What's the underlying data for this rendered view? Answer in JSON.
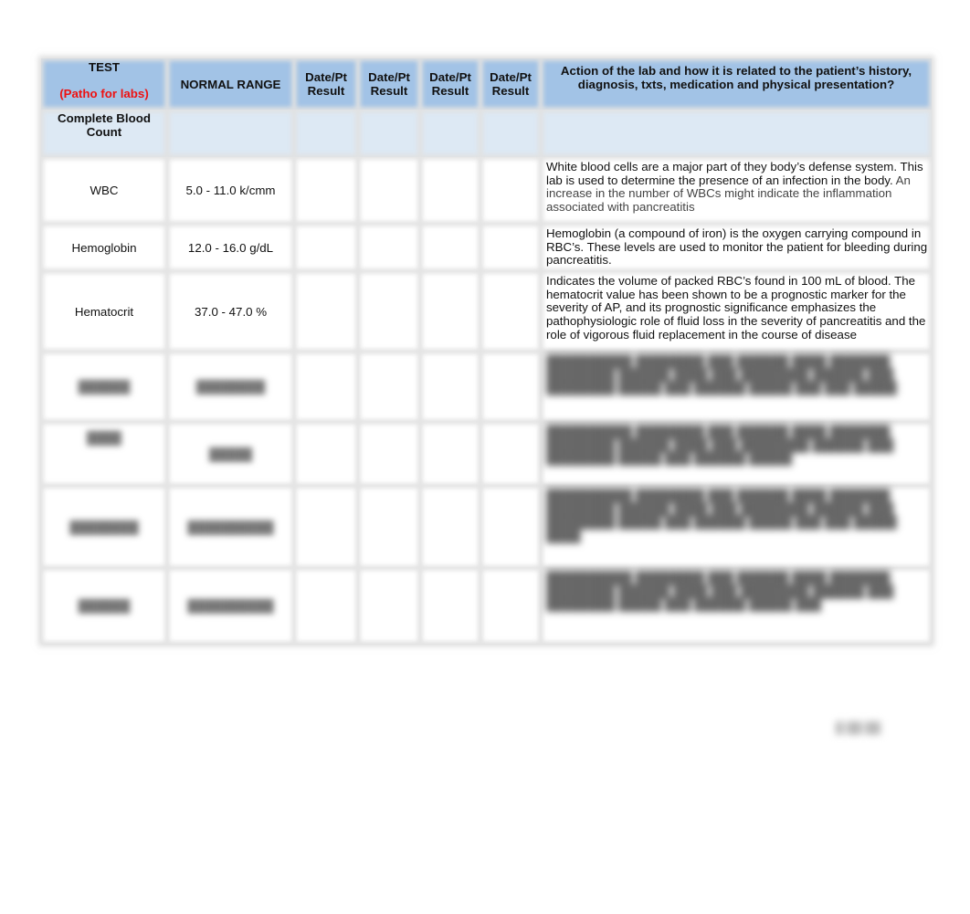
{
  "header": {
    "test_label": "TEST",
    "test_sublabel": "(Patho for labs)",
    "normal_range_label": "NORMAL RANGE",
    "result_columns": [
      "Date/Pt Result",
      "Date/Pt Result",
      "Date/Pt Result",
      "Date/Pt Result"
    ],
    "action_label": "Action of the lab and how it is related to the patient’s history, diagnosis, txts, medication and physical presentation?",
    "colors": {
      "header_bg": "#a2c3e6",
      "subheader_bg": "#dde9f4",
      "accent_red": "#ee1111"
    }
  },
  "section": {
    "label": "Complete Blood Count"
  },
  "rows": [
    {
      "test": "WBC",
      "range": "5.0 - 11.0 k/cmm",
      "results": [
        "",
        "",
        "",
        ""
      ],
      "action_main": "White blood cells are a major part of they body’s defense system. This lab is used to determine the presence of an infection in the body.",
      "action_extra": " An increase in the number of WBCs might indicate the inflammation associated with pancreatitis"
    },
    {
      "test": "Hemoglobin",
      "range": "12.0 - 16.0 g/dL",
      "results": [
        "",
        "",
        "",
        ""
      ],
      "action_main": "Hemoglobin (a compound of iron) is the oxygen carrying compound in RBC’s. These levels are used to monitor the patient for bleeding during pancreatitis.",
      "action_extra": ""
    },
    {
      "test": "Hematocrit",
      "range": "37.0 - 47.0 %",
      "results": [
        "",
        "",
        "",
        ""
      ],
      "action_main": "Indicates the volume of packed RBC’s found in 100 mL of blood. The hematocrit value has been shown to be a prognostic marker for the severity of AP, and its prognostic significance emphasizes the pathophysiologic role of fluid loss in the severity of pancreatitis and the role of vigorous fluid replacement in the course of disease",
      "action_extra": ""
    }
  ],
  "blurred_rows": [
    {
      "test": "██████",
      "range": "████████",
      "action": "██████████ ████████ ███ ██████ ████ ███████ ████████ ██████ ████ ███ ████████ ██████ ███ ████████ █████ ███ ██████ █████ ███ ███ █████"
    },
    {
      "test": "████",
      "range": "█████",
      "action": "██████████ ████████ ███ ██████ ████ ███████ ████████ ██████ ████ ███ ████████ ██████ ███ ████████ █████ ███ ██████ █████"
    },
    {
      "test": "████████",
      "range": "██████████",
      "action": "██████████ ████████ ███ ██████ ████ ███████ ████████ ██████ ████ ███ ████████ ██████ ███ ████████ █████ ███ ██████ █████ ███ ███ █████ ████"
    },
    {
      "test": "██████",
      "range": "██████████",
      "action": "██████████ ████████ ███ ██████ ████ ███████ ████████ ██████ ████ ███ ████████ ██████ ███ ████████ █████ ███ ██████ █████ ███"
    }
  ],
  "footer": {
    "page_indicator": "█ ██ ██"
  }
}
